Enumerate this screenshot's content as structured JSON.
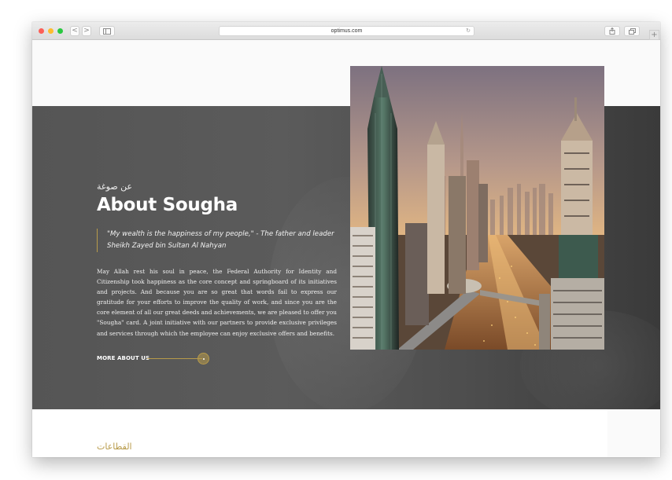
{
  "browser": {
    "url": "optimus.com",
    "back": "<",
    "forward": ">",
    "reload": "↻",
    "new_tab": "+"
  },
  "hero": {
    "arabic_subtitle": "عن صوغة",
    "title": "About Sougha",
    "quote": "\"My wealth is the happiness of my people,\" - The father and leader Sheikh Zayed bin Sultan Al Nahyan",
    "body": "May Allah rest his soul in peace, the Federal Authority for Identity and Citizenship took happiness as the core concept and springboard of its initiatives and projects. And because you are so great that words fail to express our gratitude for your efforts to improve the quality of work, and since you are the core element of all our great deeds and achievements, we are pleased to offer you \"Sougha\" card. A joint initiative with our partners to provide exclusive privileges and services through which the employee can enjoy exclusive offers and benefits.",
    "more_link": "MORE ABOUT US"
  },
  "sectors": {
    "heading": "القطاعات"
  },
  "colors": {
    "accent": "#b89b4a",
    "dark_band": "#555555"
  }
}
